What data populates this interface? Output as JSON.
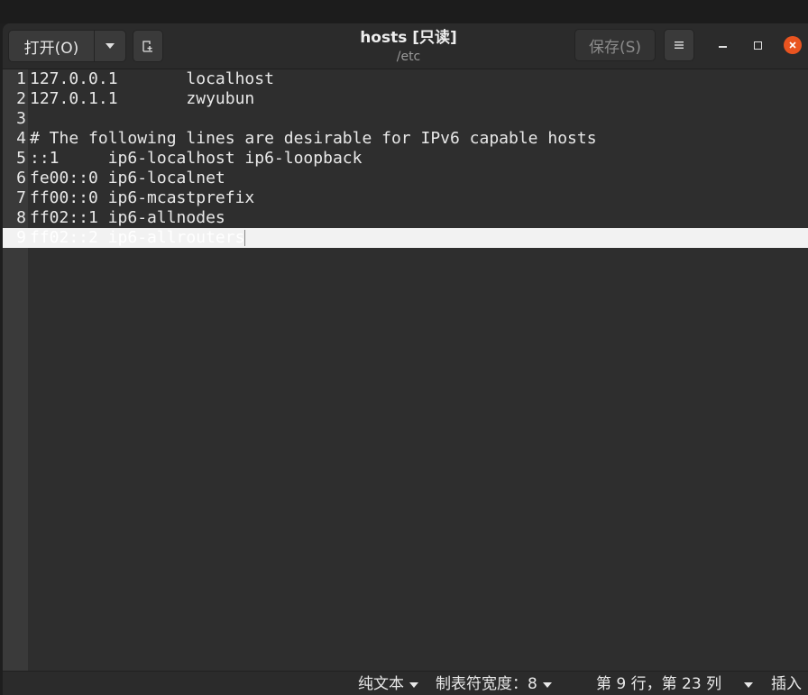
{
  "header": {
    "open_label": "打开(O)",
    "title": "hosts [只读]",
    "subtitle": "/etc",
    "save_label": "保存(S)"
  },
  "icons": {
    "open_menu": "chevron-down-icon",
    "new_tab": "new-document-icon",
    "menu": "hamburger-icon",
    "minimize": "minimize-icon",
    "maximize": "maximize-icon",
    "close": "close-icon"
  },
  "colors": {
    "close_button": "#e95420",
    "current_line": "#f2f2f2"
  },
  "editor": {
    "lines": [
      {
        "num": "1",
        "text": "127.0.0.1       localhost"
      },
      {
        "num": "2",
        "text": "127.0.1.1       zwyubun"
      },
      {
        "num": "3",
        "text": ""
      },
      {
        "num": "4",
        "text": "# The following lines are desirable for IPv6 capable hosts"
      },
      {
        "num": "5",
        "text": "::1     ip6-localhost ip6-loopback"
      },
      {
        "num": "6",
        "text": "fe00::0 ip6-localnet"
      },
      {
        "num": "7",
        "text": "ff00::0 ip6-mcastprefix"
      },
      {
        "num": "8",
        "text": "ff02::1 ip6-allnodes"
      },
      {
        "num": "9",
        "text": "ff02::2 ip6-allrouters"
      }
    ],
    "current_line": 9
  },
  "statusbar": {
    "language": "纯文本",
    "tab_width": "制表符宽度：8",
    "position": "第 9 行，第 23 列",
    "mode": "插入"
  }
}
